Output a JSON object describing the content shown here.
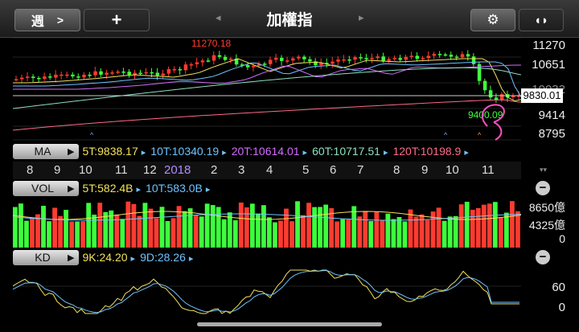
{
  "header": {
    "period_label": "週",
    "period_chevron": ">",
    "add_label": "+",
    "title": "加權指",
    "prev_arrow": "◂",
    "next_arrow": "▸",
    "gear_glyph": "⚙",
    "flip_glyph": "◖◗"
  },
  "price_axis": [
    "11270",
    "10651",
    "10032",
    "9414",
    "8795"
  ],
  "price_current": "9830.01",
  "annotations": {
    "high": "11270.18",
    "low": "9400.09"
  },
  "ma": {
    "label": "MA",
    "items": [
      {
        "text": "5T:9838.17",
        "color": "#f2e15b"
      },
      {
        "text": "10T:10340.19",
        "color": "#6ec3ff"
      },
      {
        "text": "20T:10614.01",
        "color": "#d36bff"
      },
      {
        "text": "60T:10717.51",
        "color": "#8fe0c0"
      },
      {
        "text": "120T:10198.9",
        "color": "#ff6a8a"
      }
    ]
  },
  "months": [
    "8",
    "9",
    "10",
    "11",
    "12",
    "2018",
    "2",
    "3",
    "4",
    "5",
    "6",
    "7",
    "8",
    "9",
    "10",
    "11"
  ],
  "year_color": "#b38bff",
  "vol": {
    "label": "VOL",
    "items": [
      {
        "text": "5T:582.4B",
        "color": "#f2e15b"
      },
      {
        "text": "10T:583.0B",
        "color": "#6ec3ff"
      }
    ],
    "axis": [
      "8650億",
      "4325億",
      "0"
    ]
  },
  "kd": {
    "label": "KD",
    "items": [
      {
        "text": "9K:24.20",
        "color": "#f2e15b"
      },
      {
        "text": "9D:28.26",
        "color": "#6ec3ff"
      }
    ],
    "axis": [
      "60",
      "0"
    ]
  },
  "colors": {
    "up": "#ff3b30",
    "down": "#3dff3d",
    "bg": "#000000"
  }
}
